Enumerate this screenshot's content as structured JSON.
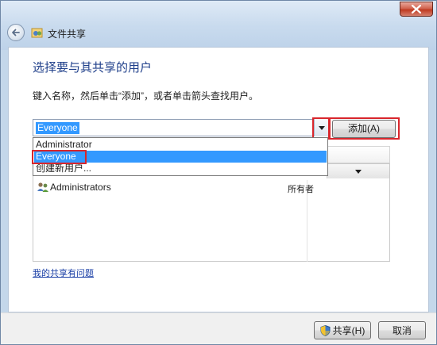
{
  "window": {
    "title": "文件共享"
  },
  "main": {
    "heading": "选择要与其共享的用户",
    "instruction": "键入名称，然后单击“添加”，或者单击箭头查找用户。"
  },
  "combo": {
    "value": "Everyone",
    "add_label": "添加(A)"
  },
  "dropdown": {
    "items": [
      {
        "label": "Administrator"
      },
      {
        "label": "Everyone"
      },
      {
        "label": "创建新用户..."
      }
    ],
    "selected_index": 1
  },
  "list": {
    "rows": [
      {
        "name": "Administrators",
        "permission": "所有者"
      }
    ]
  },
  "help_link": "我的共享有问题",
  "footer": {
    "share_label": "共享(H)",
    "cancel_label": "取消"
  },
  "icons": {
    "close": "close-icon",
    "back": "back-arrow-icon",
    "title": "file-share-icon",
    "dropdown": "chevron-down-icon",
    "group": "users-group-icon",
    "shield": "uac-shield-icon"
  },
  "colors": {
    "selection": "#3399ff",
    "highlight_box": "#d9262c",
    "heading": "#1f3f8a",
    "link": "#1a3fa6"
  }
}
